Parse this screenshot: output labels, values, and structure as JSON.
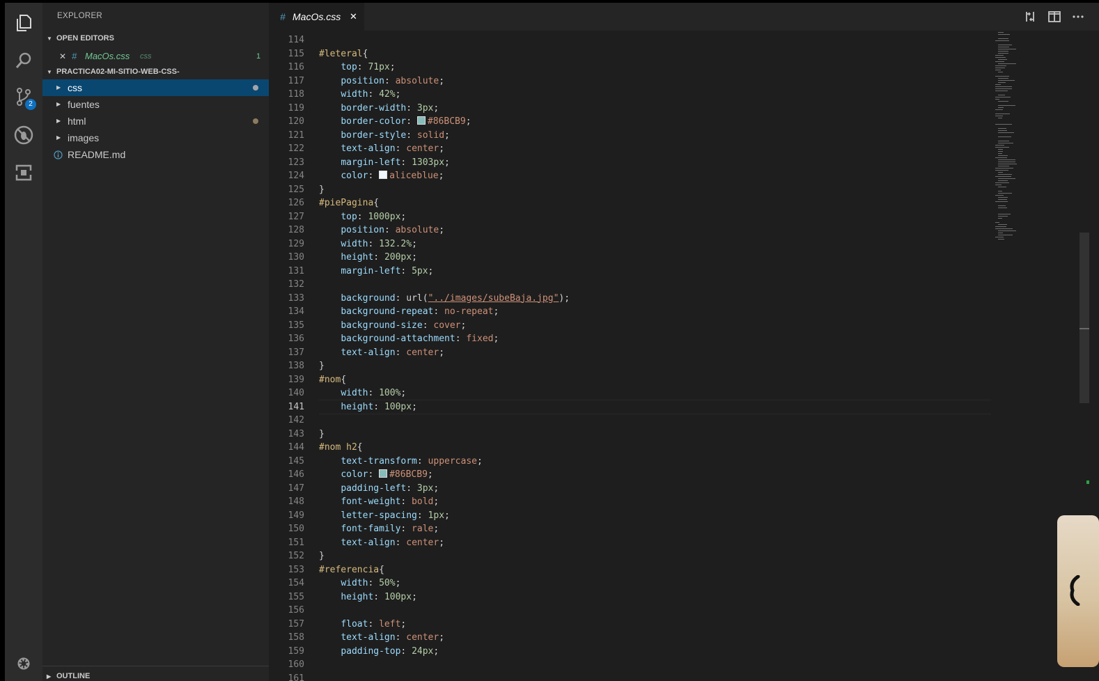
{
  "explorer": {
    "title": "EXPLORER",
    "open_editors_label": "OPEN EDITORS",
    "open_file": {
      "name": "MacOs.css",
      "lang": "css",
      "problems": "1"
    },
    "project_label": "PRACTICA02-MI-SITIO-WEB-CSS-",
    "folders": [
      {
        "name": "css",
        "selected": true,
        "modified": true
      },
      {
        "name": "fuentes",
        "selected": false,
        "modified": false
      },
      {
        "name": "html",
        "selected": false,
        "modified": true
      },
      {
        "name": "images",
        "selected": false,
        "modified": false
      }
    ],
    "readme": "README.md",
    "outline_label": "OUTLINE"
  },
  "activity": {
    "icons": [
      "files-icon",
      "search-icon",
      "source-control-icon",
      "debug-icon",
      "extensions-icon",
      "settings-gear-icon"
    ],
    "scm_badge": "2"
  },
  "tab": {
    "hash": "#",
    "name": "MacOs.css",
    "close": "✕"
  },
  "editor": {
    "current_line": 141,
    "lines": [
      {
        "n": "114",
        "t": ""
      },
      {
        "n": "115",
        "t": "#leteral{"
      },
      {
        "n": "116",
        "t": "    top: 71px;"
      },
      {
        "n": "117",
        "t": "    position: absolute;"
      },
      {
        "n": "118",
        "t": "    width: 42%;"
      },
      {
        "n": "119",
        "t": "    border-width: 3px;"
      },
      {
        "n": "120",
        "t": "    border-color: #86BCB9;"
      },
      {
        "n": "121",
        "t": "    border-style: solid;"
      },
      {
        "n": "122",
        "t": "    text-align: center;"
      },
      {
        "n": "123",
        "t": "    margin-left: 1303px;"
      },
      {
        "n": "124",
        "t": "    color: aliceblue;"
      },
      {
        "n": "125",
        "t": "}"
      },
      {
        "n": "126",
        "t": "#piePagina{"
      },
      {
        "n": "127",
        "t": "    top: 1000px;"
      },
      {
        "n": "128",
        "t": "    position: absolute;"
      },
      {
        "n": "129",
        "t": "    width: 132.2%;"
      },
      {
        "n": "130",
        "t": "    height: 200px;"
      },
      {
        "n": "131",
        "t": "    margin-left: 5px;"
      },
      {
        "n": "132",
        "t": ""
      },
      {
        "n": "133",
        "t": "    background: url(\"../images/subeBaja.jpg\");"
      },
      {
        "n": "134",
        "t": "    background-repeat: no-repeat;"
      },
      {
        "n": "135",
        "t": "    background-size: cover;"
      },
      {
        "n": "136",
        "t": "    background-attachment: fixed;"
      },
      {
        "n": "137",
        "t": "    text-align: center;"
      },
      {
        "n": "138",
        "t": "}"
      },
      {
        "n": "139",
        "t": "#nom{"
      },
      {
        "n": "140",
        "t": "    width: 100%;"
      },
      {
        "n": "141",
        "t": "    height: 100px;"
      },
      {
        "n": "142",
        "t": ""
      },
      {
        "n": "143",
        "t": "}"
      },
      {
        "n": "144",
        "t": "#nom h2{"
      },
      {
        "n": "145",
        "t": "    text-transform: uppercase;"
      },
      {
        "n": "146",
        "t": "    color: #86BCB9;"
      },
      {
        "n": "147",
        "t": "    padding-left: 3px;"
      },
      {
        "n": "148",
        "t": "    font-weight: bold;"
      },
      {
        "n": "149",
        "t": "    letter-spacing: 1px;"
      },
      {
        "n": "150",
        "t": "    font-family: rale;"
      },
      {
        "n": "151",
        "t": "    text-align: center;"
      },
      {
        "n": "152",
        "t": "}"
      },
      {
        "n": "153",
        "t": "#referencia{"
      },
      {
        "n": "154",
        "t": "    width: 50%;"
      },
      {
        "n": "155",
        "t": "    height: 100px;"
      },
      {
        "n": "156",
        "t": ""
      },
      {
        "n": "157",
        "t": "    float: left;"
      },
      {
        "n": "158",
        "t": "    text-align: center;"
      },
      {
        "n": "159",
        "t": "    padding-top: 24px;"
      },
      {
        "n": "160",
        "t": ""
      },
      {
        "n": "161",
        "t": ""
      }
    ]
  },
  "colors": {
    "accent": "#094771",
    "swatch_teal": "#86BCB9",
    "swatch_aliceblue": "#F0F8FF",
    "badge": "#0e70c0",
    "modified_dot_css": "#a0a4ab",
    "modified_dot_html": "#8c7b5e"
  }
}
